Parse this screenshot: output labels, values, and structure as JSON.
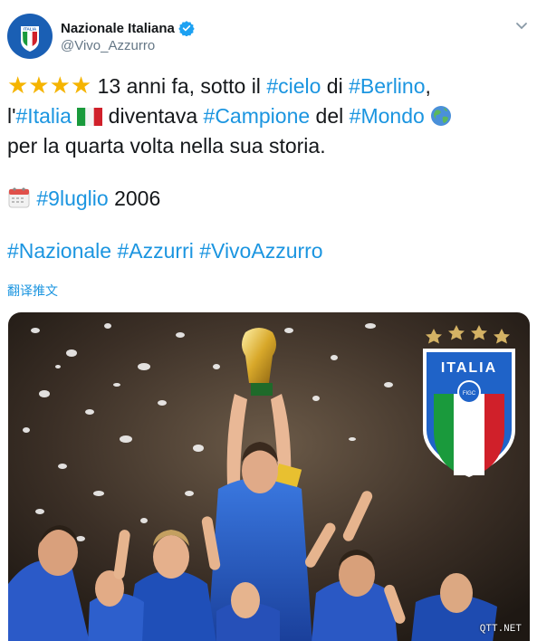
{
  "account": {
    "name": "Nazionale Italiana",
    "handle": "@Vivo_Azzurro",
    "avatar_text": "ITALIA"
  },
  "tweet": {
    "line1": {
      "stars": "★★★★",
      "text_a": " 13 anni fa, sotto il ",
      "tag_a": "#cielo",
      "text_b": " di ",
      "tag_b": "#Berlino",
      "text_c": ","
    },
    "line2": {
      "text_a": "l'",
      "tag_a": "#Italia",
      "flag": "🇮🇹",
      "text_b": " diventava ",
      "tag_b": "#Campione",
      "text_c": " del ",
      "tag_c": "#Mondo",
      "globe": "🌍"
    },
    "line3": "per la quarta volta nella sua storia.",
    "line4": {
      "calendar": "📅",
      "tag": "#9luglio",
      "year": " 2006"
    },
    "line5": [
      "#Nazionale",
      "#Azzurri",
      "#VivoAzzurro"
    ]
  },
  "translate_label": "翻译推文",
  "image": {
    "badge_text": "ITALIA",
    "badge_sub": "FIGC",
    "watermark": "QTT.NET"
  },
  "colors": {
    "link": "#1b95e0",
    "verified": "#1da1f2",
    "azzurro": "#1a5fb4",
    "italy_green": "#1a9a3c",
    "italy_red": "#d0202a"
  }
}
